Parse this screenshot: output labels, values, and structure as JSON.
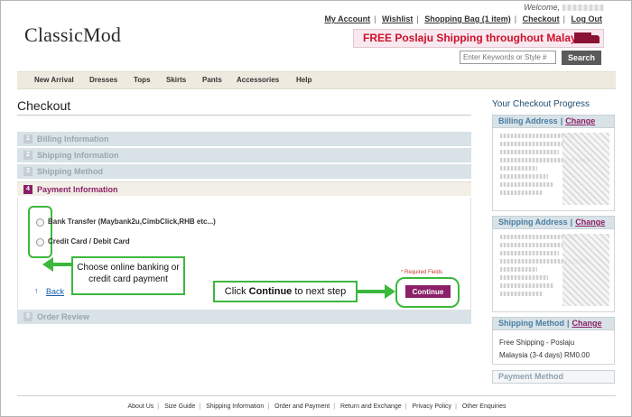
{
  "header": {
    "welcome_text": "Welcome,",
    "top_links": [
      "My Account",
      "Wishlist",
      "Shopping Bag (1 item)",
      "Checkout",
      "Log Out"
    ],
    "logo_text": "ClassicMod",
    "banner_text": "FREE Poslaju Shipping throughout Malaysia",
    "search_placeholder": "Enter Keywords or Style #",
    "search_button": "Search"
  },
  "nav": [
    "New Arrival",
    "Dresses",
    "Tops",
    "Skirts",
    "Pants",
    "Accessories",
    "Help"
  ],
  "checkout": {
    "title": "Checkout",
    "steps": [
      {
        "num": "1",
        "label": "Billing Information"
      },
      {
        "num": "2",
        "label": "Shipping Information"
      },
      {
        "num": "3",
        "label": "Shipping Method"
      },
      {
        "num": "4",
        "label": "Payment Information"
      },
      {
        "num": "5",
        "label": "Order Review"
      }
    ],
    "payment_options": [
      "Bank Transfer (Maybank2u,CimbClick,RHB etc...)",
      "Credit Card / Debit Card"
    ],
    "callout_payment": "Choose online banking or credit card payment",
    "callout_continue_pre": "Click ",
    "callout_continue_bold": "Continue",
    "callout_continue_post": " to next step",
    "required_note": "* Required Fields",
    "back_label": "Back",
    "continue_label": "Continue"
  },
  "sidebar": {
    "title": "Your Checkout Progress",
    "billing_label": "Billing Address",
    "shipping_label": "Shipping Address",
    "method_label": "Shipping Method",
    "change_label": "Change",
    "pipe": "|",
    "method_line1": "Free Shipping - Poslaju",
    "method_line2": "Malaysia (3-4 days) RM0.00",
    "payment_label": "Payment Method"
  },
  "footer": [
    "About Us",
    "Size Guide",
    "Shipping Information",
    "Order and Payment",
    "Return and Exchange",
    "Privacy Policy",
    "Other Enquiries"
  ],
  "colors": {
    "accent": "#8b1f68",
    "callout_border": "#3cb83c",
    "step_bg": "#d8e2e7",
    "banner_text": "#d0102a"
  }
}
